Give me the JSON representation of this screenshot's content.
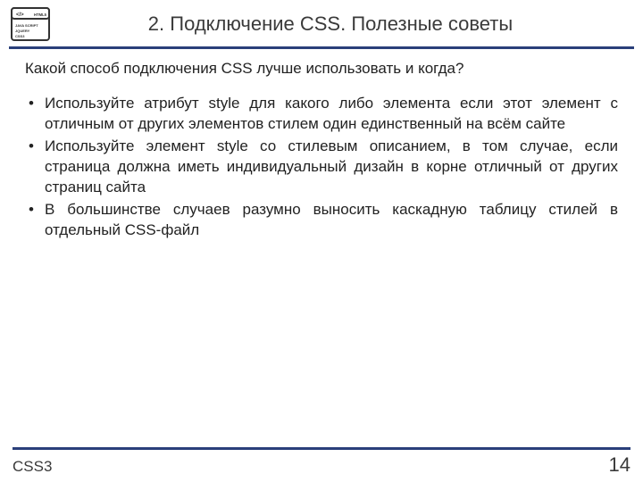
{
  "header": {
    "title": "2. Подключение CSS. Полезные советы"
  },
  "content": {
    "question": "Какой способ подключения CSS лучше использовать и когда?",
    "bullets": [
      "Используйте атрибут style для какого либо элемента если этот элемент с отличным от других элементов стилем один единственный на всём сайте",
      "Используйте элемент style со стилевым описанием, в том случае, если страница должна иметь индивидуальный дизайн в корне отличный от других страниц сайта",
      "В большинстве случаев разумно выносить каскадную таблицу стилей в отдельный CSS-файл"
    ]
  },
  "footer": {
    "label": "CSS3",
    "page": "14"
  }
}
